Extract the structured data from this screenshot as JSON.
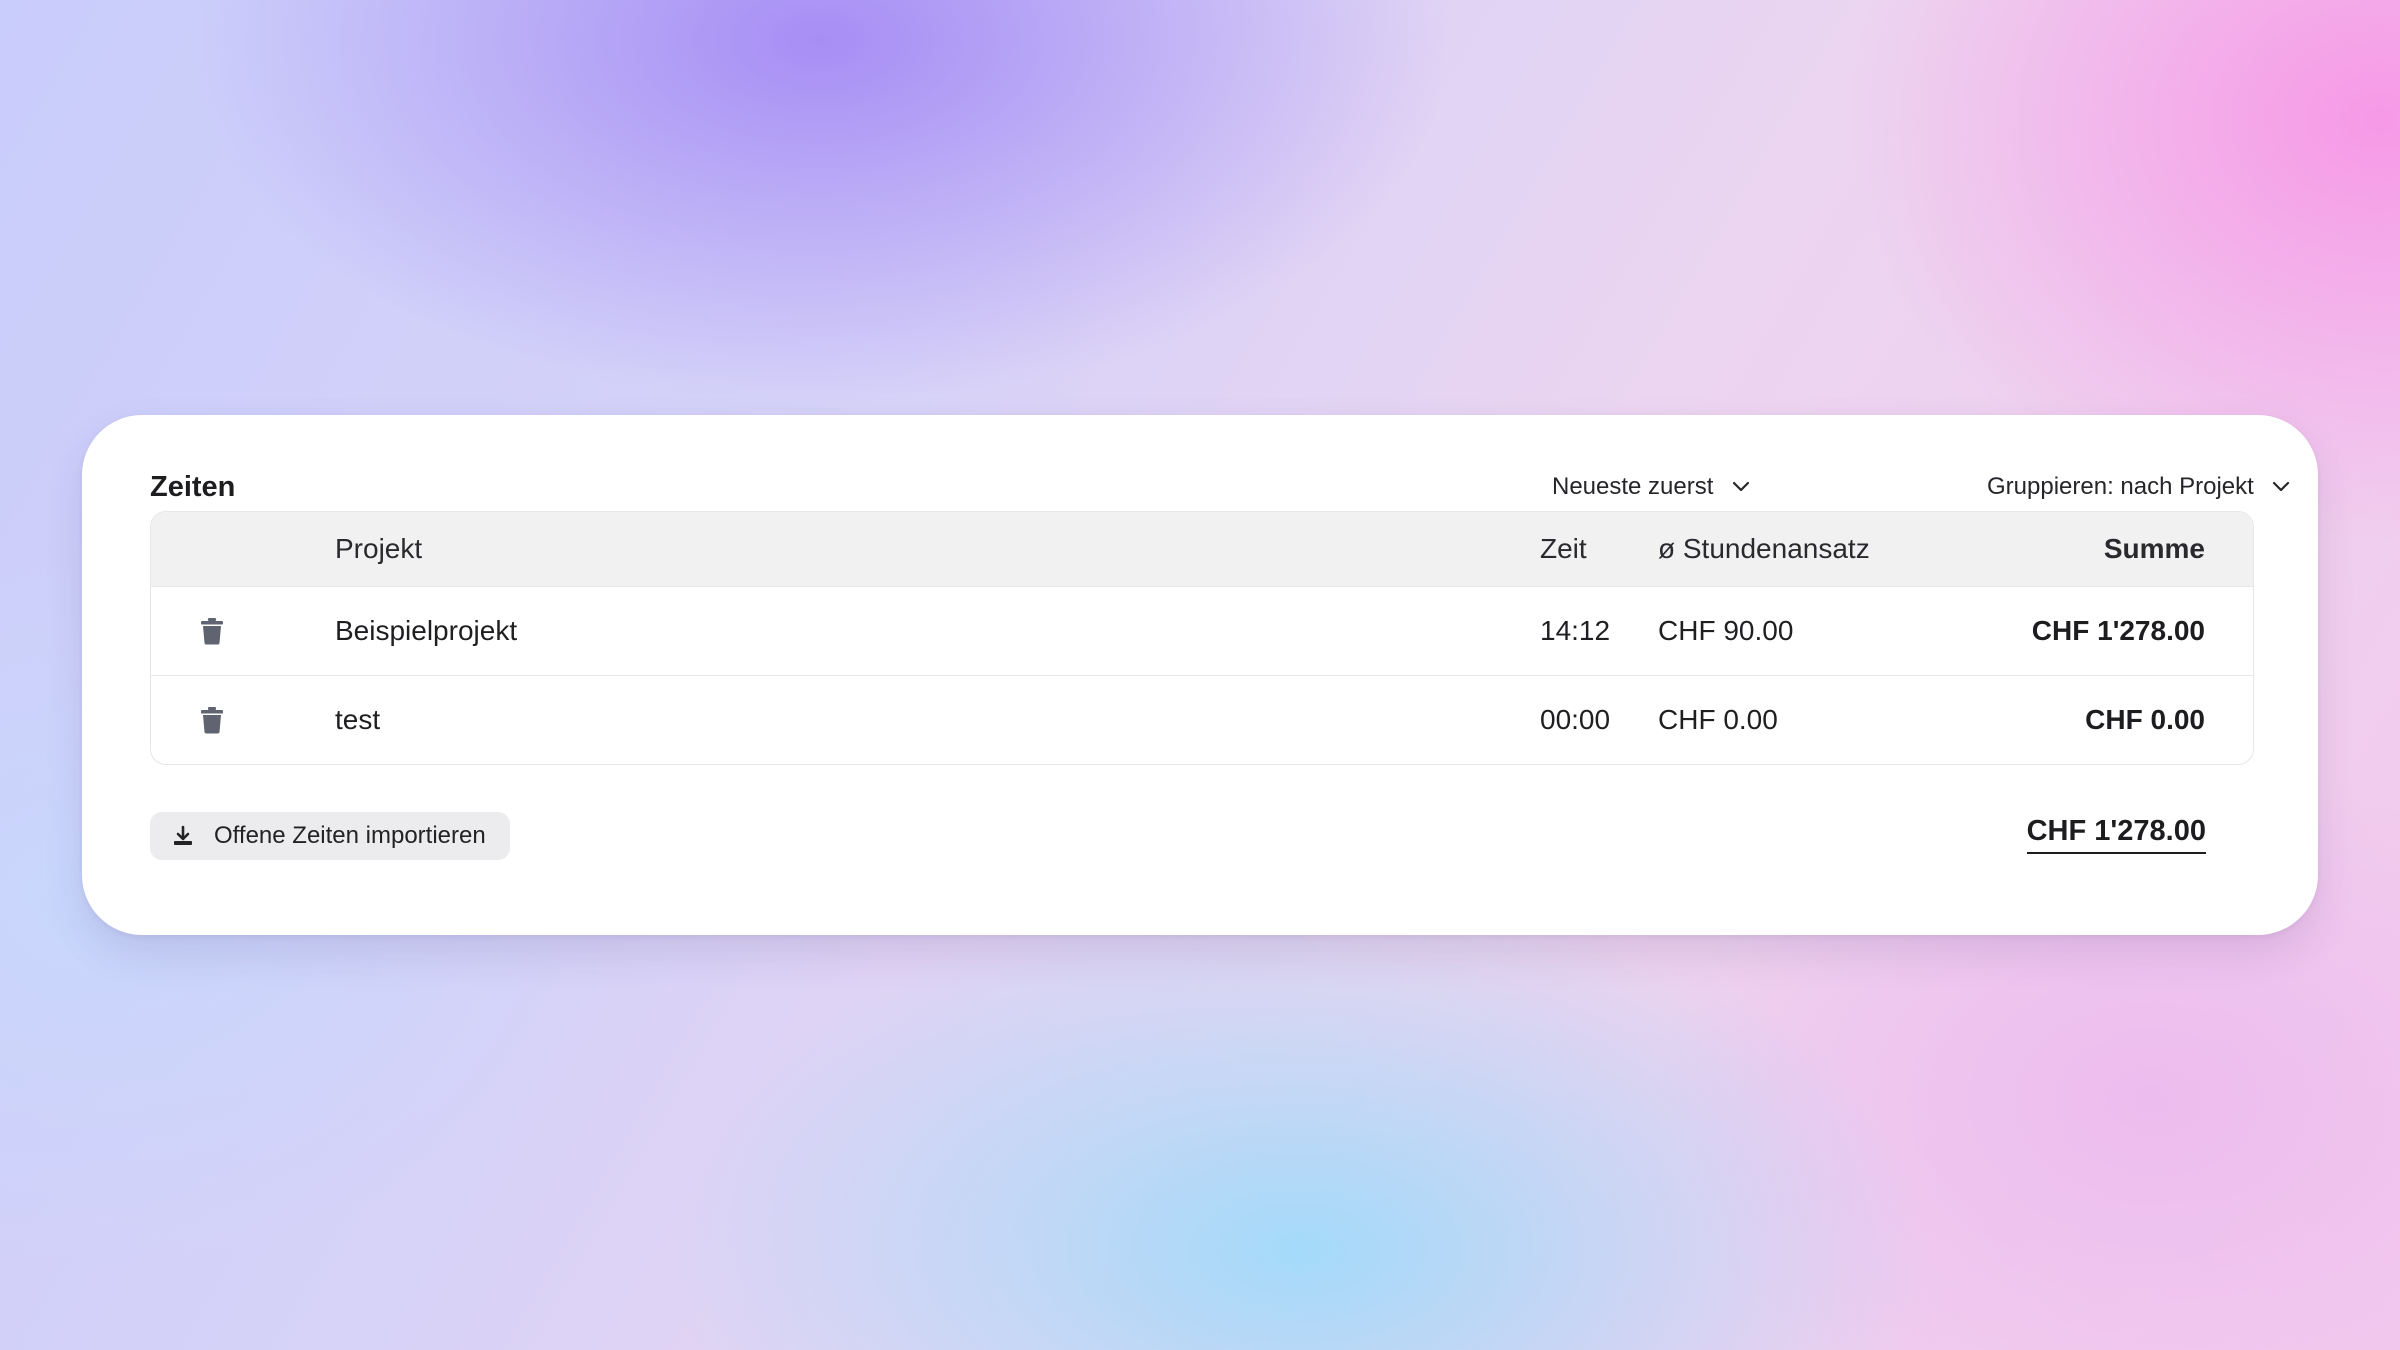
{
  "card": {
    "title": "Zeiten",
    "sort": {
      "selected": "Neueste zuerst",
      "icon": "chevron-down-icon"
    },
    "grouping": {
      "selected": "Gruppieren: nach Projekt",
      "icon": "chevron-down-icon"
    }
  },
  "table": {
    "columns": {
      "project": "Projekt",
      "time": "Zeit",
      "rate": "ø Stundenansatz",
      "sum": "Summe"
    },
    "rows": [
      {
        "project": "Beispielprojekt",
        "time": "14:12",
        "rate": "CHF 90.00",
        "sum": "CHF 1'278.00",
        "icon": "trash-icon"
      },
      {
        "project": "test",
        "time": "00:00",
        "rate": "CHF 0.00",
        "sum": "CHF 0.00",
        "icon": "trash-icon"
      }
    ]
  },
  "footer": {
    "import_label": "Offene Zeiten importieren",
    "import_icon": "download-icon",
    "total": "CHF 1'278.00"
  },
  "colors": {
    "card_bg": "#ffffff",
    "table_header_bg": "#f1f1f2",
    "button_bg": "#ececee",
    "icon_gray": "#5f6470",
    "text_dark": "#1d1d20"
  }
}
